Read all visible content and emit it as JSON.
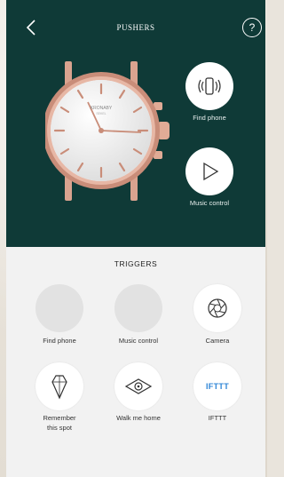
{
  "header": {
    "title": "PUSHERS",
    "help_symbol": "?",
    "back_icon": "chevron-left-icon"
  },
  "watch": {
    "brand": "KRONABY",
    "brand_sub": "SEKEL"
  },
  "pushers": [
    {
      "label": "Find phone",
      "icon": "phone-vibrate-icon"
    },
    {
      "label": "Music control",
      "icon": "play-icon"
    }
  ],
  "triggers": {
    "title": "TRIGGERS",
    "items": [
      {
        "label": "Find phone",
        "icon": ""
      },
      {
        "label": "Music control",
        "icon": ""
      },
      {
        "label": "Camera",
        "icon": "camera-shutter-icon"
      },
      {
        "label": "Remember\nthis spot",
        "line1": "Remember",
        "line2": "this spot",
        "icon": "pin-icon"
      },
      {
        "label": "Walk me home",
        "icon": "eye-icon"
      },
      {
        "label": "IFTTT",
        "icon_text": "IFTTT",
        "icon": "ifttt-logo"
      }
    ]
  },
  "colors": {
    "header_bg": "#0f3a37",
    "ifttt_blue": "#2f86d7"
  }
}
